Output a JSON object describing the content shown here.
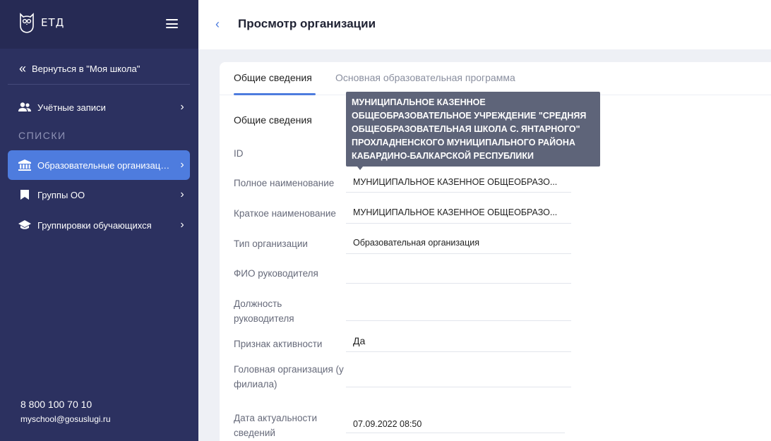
{
  "sidebar": {
    "logo_text": "ЕТД",
    "back_link": "Вернуться в \"Моя школа\"",
    "items": [
      {
        "label": "Учётные записи"
      },
      {
        "label": "Образовательные организации"
      },
      {
        "label": "Группы ОО"
      },
      {
        "label": "Группировки обучающихся"
      }
    ],
    "section_title": "СПИСКИ",
    "phone": "8 800 100 70 10",
    "email": "myschool@gosuslugi.ru"
  },
  "header": {
    "title": "Просмотр организации"
  },
  "tabs": [
    {
      "label": "Общие сведения"
    },
    {
      "label": "Основная образовательная программа"
    }
  ],
  "section_heading": "Общие сведения",
  "fields": [
    {
      "label": "ID",
      "value": ""
    },
    {
      "label": "Полное наименование",
      "value": "МУНИЦИПАЛЬНОЕ КАЗЕННОЕ ОБЩЕОБРАЗО..."
    },
    {
      "label": "Краткое наименование",
      "value": "МУНИЦИПАЛЬНОЕ КАЗЕННОЕ ОБЩЕОБРАЗО..."
    },
    {
      "label": "Тип организации",
      "value": "Образовательная организация"
    },
    {
      "label": "ФИО руководителя",
      "value": ""
    },
    {
      "label": "Должность руководителя",
      "value": ""
    },
    {
      "label": "Признак активности",
      "value": "Да"
    },
    {
      "label": "Головная организация (у филиала)",
      "value": ""
    },
    {
      "label": "Дата актуальности сведений",
      "value": "07.09.2022 08:50"
    }
  ],
  "tooltip": {
    "text": "МУНИЦИПАЛЬНОЕ КАЗЕННОЕ ОБЩЕОБРАЗОВАТЕЛЬНОЕ УЧРЕЖДЕНИЕ \"СРЕДНЯЯ ОБЩЕОБРАЗОВАТЕЛЬНАЯ ШКОЛА С. ЯНТАРНОГО\" ПРОХЛАДНЕНСКОГО МУНИЦИПАЛЬНОГО РАЙОНА КАБАРДИНО-БАЛКАРСКОЙ РЕСПУБЛИКИ"
  },
  "colors": {
    "sidebar_bg": "#2c3160",
    "accent": "#4e7cde",
    "tooltip_bg": "#5e6479"
  }
}
